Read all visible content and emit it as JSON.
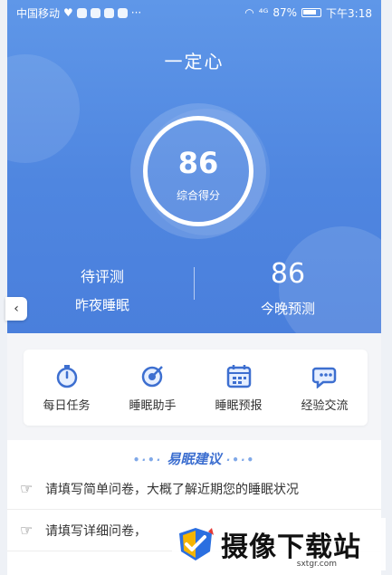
{
  "status": {
    "carrier": "中国移动",
    "ellipsis": "···",
    "network": "⁴ᴳ",
    "battery": "87%",
    "time": "下午3:18"
  },
  "header": {
    "title": "一定心"
  },
  "score": {
    "value": "86",
    "label": "综合得分"
  },
  "stats": {
    "left": {
      "value": "待评测",
      "label": "昨夜睡眠"
    },
    "right": {
      "value": "86",
      "label": "今晚预测"
    }
  },
  "features": [
    {
      "label": "每日任务",
      "icon": "stopwatch-icon"
    },
    {
      "label": "睡眠助手",
      "icon": "target-icon"
    },
    {
      "label": "睡眠预报",
      "icon": "calendar-icon"
    },
    {
      "label": "经验交流",
      "icon": "chat-icon"
    }
  ],
  "advice": {
    "title": "易眠建议",
    "items": [
      "请填写简单问卷，大概了解近期您的睡眠状况",
      "请填写详细问卷，"
    ]
  },
  "watermark": {
    "text": "摄像下载站",
    "site": "sxtgr.com"
  },
  "colors": {
    "primary": "#4f86e0",
    "accent": "#3d6fd0"
  }
}
